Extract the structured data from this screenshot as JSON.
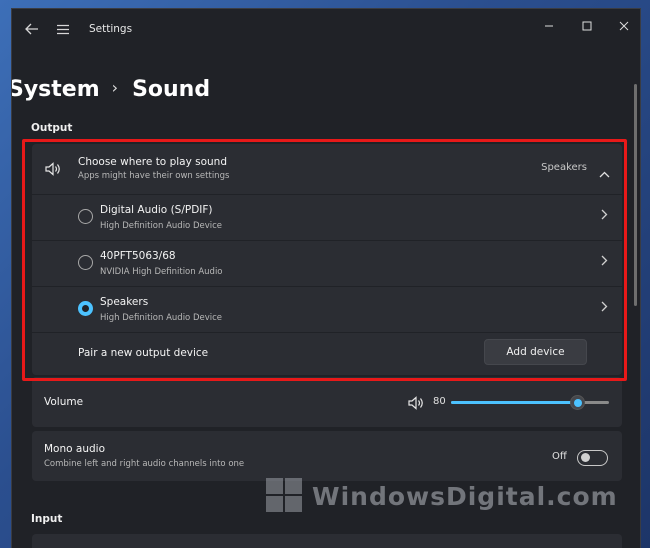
{
  "window": {
    "app_title": "Settings",
    "icons": {
      "back": "back-arrow-icon",
      "menu": "hamburger-icon",
      "minimize": "minimize-icon",
      "maximize": "maximize-icon",
      "close": "close-icon"
    }
  },
  "breadcrumb": {
    "parent": "System",
    "separator": "›",
    "current": "Sound"
  },
  "output": {
    "section_label": "Output",
    "choose": {
      "title": "Choose where to play sound",
      "subtitle": "Apps might have their own settings",
      "selected_value": "Speakers",
      "icon": "speaker-icon",
      "expanded": true
    },
    "devices": [
      {
        "name": "Digital Audio (S/PDIF)",
        "description": "High Definition Audio Device",
        "selected": false
      },
      {
        "name": "40PFT5063/68",
        "description": "NVIDIA High Definition Audio",
        "selected": false
      },
      {
        "name": "Speakers",
        "description": "High Definition Audio Device",
        "selected": true
      }
    ],
    "pair": {
      "label": "Pair a new output device",
      "button": "Add device"
    },
    "volume": {
      "label": "Volume",
      "value": "80",
      "level": 80
    },
    "mono": {
      "title": "Mono audio",
      "subtitle": "Combine left and right audio channels into one",
      "state": "Off"
    }
  },
  "input": {
    "section_label": "Input"
  },
  "watermark": {
    "text": "WindowsDigital.com"
  },
  "colors": {
    "accent": "#4cc2ff",
    "highlight_box": "#e81919",
    "card": "#2b2d33",
    "window": "#202227"
  }
}
